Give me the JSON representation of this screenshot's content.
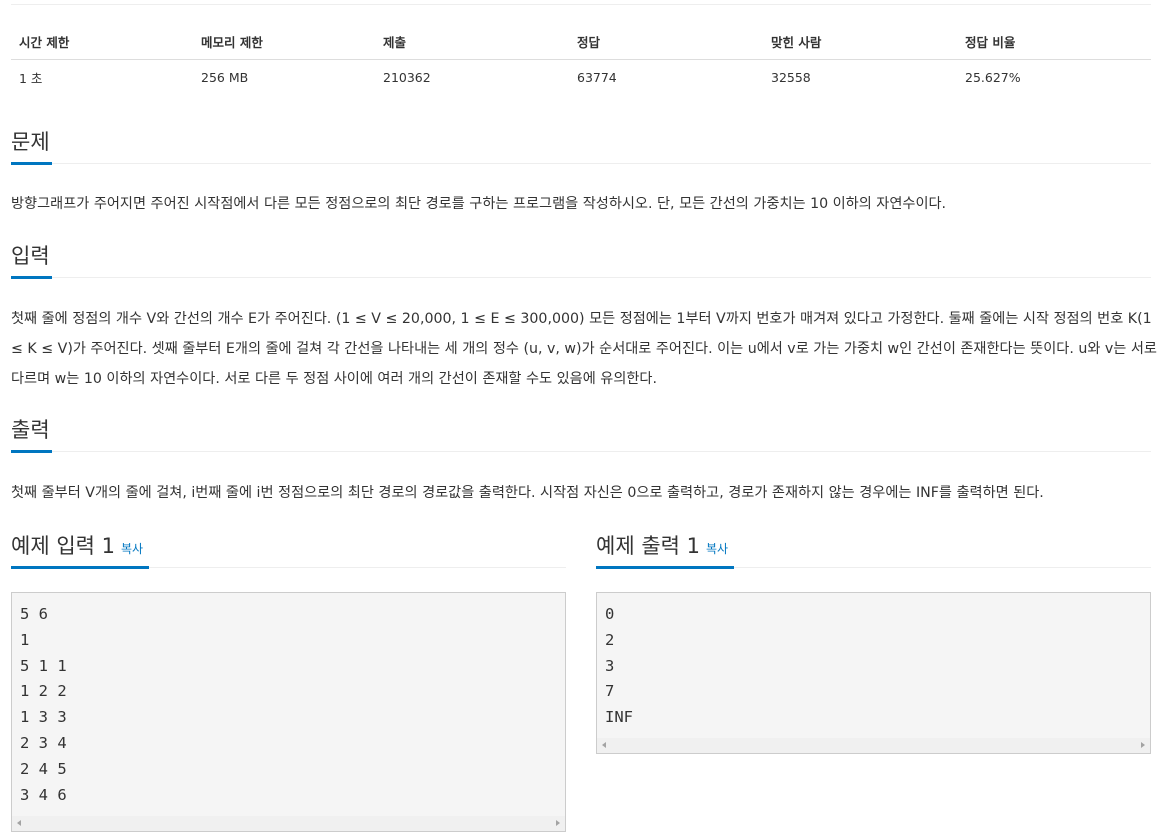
{
  "info_table": {
    "headers": [
      "시간 제한",
      "메모리 제한",
      "제출",
      "정답",
      "맞힌 사람",
      "정답 비율"
    ],
    "values": [
      "1 초",
      "256 MB",
      "210362",
      "63774",
      "32558",
      "25.627%"
    ]
  },
  "problem": {
    "title": "문제",
    "body": "방향그래프가 주어지면 주어진 시작점에서 다른 모든 정점으로의 최단 경로를 구하는 프로그램을 작성하시오. 단, 모든 간선의 가중치는 10 이하의 자연수이다."
  },
  "input": {
    "title": "입력",
    "body": "첫째 줄에 정점의 개수 V와 간선의 개수 E가 주어진다. (1 ≤ V ≤ 20,000, 1 ≤ E ≤ 300,000) 모든 정점에는 1부터 V까지 번호가 매겨져 있다고 가정한다. 둘째 줄에는 시작 정점의 번호 K(1 ≤ K ≤ V)가 주어진다. 셋째 줄부터 E개의 줄에 걸쳐 각 간선을 나타내는 세 개의 정수 (u, v, w)가 순서대로 주어진다. 이는 u에서 v로 가는 가중치 w인 간선이 존재한다는 뜻이다. u와 v는 서로 다르며 w는 10 이하의 자연수이다. 서로 다른 두 정점 사이에 여러 개의 간선이 존재할 수도 있음에 유의한다."
  },
  "output": {
    "title": "출력",
    "body": "첫째 줄부터 V개의 줄에 걸쳐, i번째 줄에 i번 정점으로의 최단 경로의 경로값을 출력한다. 시작점 자신은 0으로 출력하고, 경로가 존재하지 않는 경우에는 INF를 출력하면 된다."
  },
  "sample_input": {
    "title": "예제 입력 1",
    "copy_label": "복사",
    "content": "5 6\n1\n5 1 1\n1 2 2\n1 3 3\n2 3 4\n2 4 5\n3 4 6"
  },
  "sample_output": {
    "title": "예제 출력 1",
    "copy_label": "복사",
    "content": "0\n2\n3\n7\nINF"
  },
  "colors": {
    "accent": "#0076c0",
    "sample_bg": "#f5f5f5",
    "text": "#333333"
  }
}
